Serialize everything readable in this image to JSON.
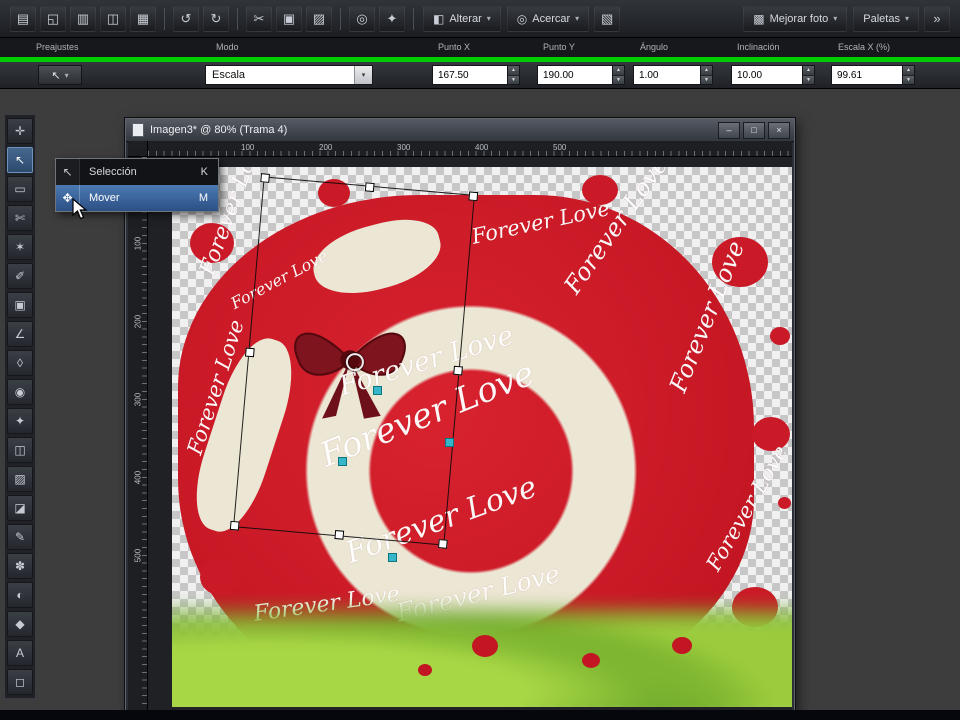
{
  "colors": {
    "green_line": "#00cd00",
    "selection_blue": "#4b7ab2",
    "canvas_red": "#cb1a27",
    "cream": "#ece6d4",
    "grass_green": "#79b32a"
  },
  "top_toolbar": {
    "caret": "▾",
    "overflow": "»",
    "icons": [
      {
        "name": "new-icon",
        "glyph": "▤"
      },
      {
        "name": "open-icon",
        "glyph": "◱"
      },
      {
        "name": "save-icon",
        "glyph": "▥"
      },
      {
        "name": "browse-icon",
        "glyph": "◫"
      },
      {
        "name": "print-icon",
        "glyph": "▦"
      },
      {
        "name": "undo-icon",
        "glyph": "↺"
      },
      {
        "name": "redo-icon",
        "glyph": "↻"
      },
      {
        "name": "cut-icon",
        "glyph": "✂"
      },
      {
        "name": "copy-icon",
        "glyph": "▣"
      },
      {
        "name": "paste-icon",
        "glyph": "▨"
      },
      {
        "name": "zoom-icon",
        "glyph": "◎"
      },
      {
        "name": "screen-capture-icon",
        "glyph": "✦"
      }
    ],
    "alterar_label": "Alterar",
    "alterar_glyph": "◧",
    "acercar_label": "Acercar",
    "acercar_glyph": "◎",
    "panel_glyph": "▧",
    "mejorar_foto_label": "Mejorar foto",
    "mejorar_glyph": "▩",
    "paletas_label": "Paletas"
  },
  "tool_options": {
    "presets_label": "Preajustes",
    "mode_label": "Modo",
    "mode_value": "Escala",
    "preset_glyph": "↖",
    "fields": [
      {
        "label": "Punto X",
        "value": "167.50"
      },
      {
        "label": "Punto Y",
        "value": "190.00"
      },
      {
        "label": "Ángulo",
        "value": "1.00"
      },
      {
        "label": "Inclinación",
        "value": "10.00"
      },
      {
        "label": "Escala X (%)",
        "value": "99.61"
      }
    ],
    "spin_up": "▲",
    "spin_down": "▼"
  },
  "tools": [
    {
      "name": "pan-tool",
      "glyph": "✛"
    },
    {
      "name": "pick-tool",
      "glyph": "↖"
    },
    {
      "name": "selection-tool",
      "glyph": "▭"
    },
    {
      "name": "freehand-selection-tool",
      "glyph": "✄"
    },
    {
      "name": "magic-wand-tool",
      "glyph": "✶"
    },
    {
      "name": "dropper-tool",
      "glyph": "✐"
    },
    {
      "name": "crop-tool",
      "glyph": "▣"
    },
    {
      "name": "straighten-tool",
      "glyph": "∠"
    },
    {
      "name": "perspective-tool",
      "glyph": "◊"
    },
    {
      "name": "red-eye-tool",
      "glyph": "◉"
    },
    {
      "name": "makeover-tool",
      "glyph": "✦"
    },
    {
      "name": "clone-tool",
      "glyph": "◫"
    },
    {
      "name": "scratch-remover-tool",
      "glyph": "▨"
    },
    {
      "name": "eraser-tool",
      "glyph": "◪"
    },
    {
      "name": "brush-tool",
      "glyph": "✎"
    },
    {
      "name": "airbrush-tool",
      "glyph": "✽"
    },
    {
      "name": "lighten-darken-tool",
      "glyph": "◐"
    },
    {
      "name": "flood-fill-tool",
      "glyph": "◆"
    },
    {
      "name": "text-tool",
      "glyph": "A"
    },
    {
      "name": "preset-shapes-tool",
      "glyph": "◻"
    }
  ],
  "flyout": {
    "items": [
      {
        "label": "Selección",
        "shortcut": "K",
        "glyph": "↖"
      },
      {
        "label": "Mover",
        "shortcut": "M",
        "glyph": "✥"
      }
    ]
  },
  "document": {
    "title": "Imagen3* @ 80% (Trama 4)",
    "zoom": "80%"
  },
  "window_controls": {
    "minimize": "–",
    "maximize": "□",
    "close": "×"
  },
  "rulers": {
    "horizontal": [
      "100",
      "200",
      "300",
      "400",
      "500"
    ],
    "vertical": [
      "100",
      "200",
      "300",
      "400",
      "500"
    ]
  },
  "canvas_art": {
    "text": "Forever Love"
  }
}
